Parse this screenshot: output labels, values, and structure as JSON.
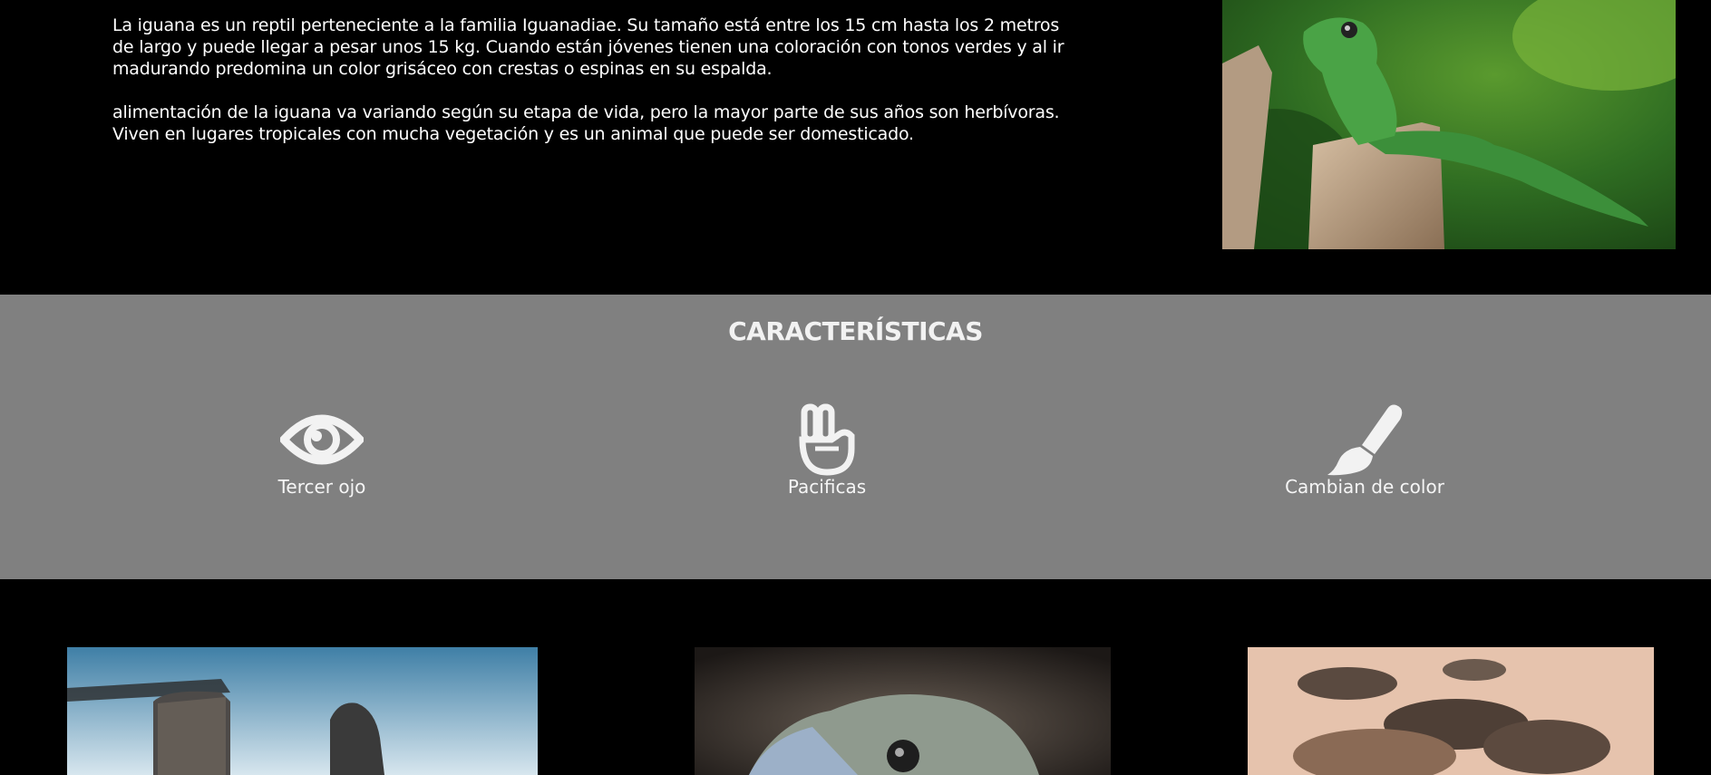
{
  "intro": {
    "paragraph_1": "La iguana es un reptil perteneciente a la familia Iguanadiae. Su tamaño está entre los 15 cm hasta los 2 metros de largo y puede llegar a pesar unos 15 kg. Cuando están jóvenes tienen una coloración con tonos verdes y al ir madurando predomina un color grisáceo con crestas o espinas en su espalda.",
    "paragraph_2": "alimentación de la iguana va variando según su etapa de vida, pero la mayor parte de sus años son herbívoras. Viven en lugares tropicales con mucha vegetación y es un animal que puede ser domesticado."
  },
  "features": {
    "title": "CARACTERÍSTICAS",
    "items": [
      {
        "label": "Tercer ojo",
        "icon": "eye-icon"
      },
      {
        "label": "Pacificas",
        "icon": "peace-hand-icon"
      },
      {
        "label": "Cambian de color",
        "icon": "paintbrush-icon"
      }
    ]
  },
  "colors": {
    "page_background": "#000000",
    "features_background": "#808080",
    "text": "#ffffff"
  }
}
